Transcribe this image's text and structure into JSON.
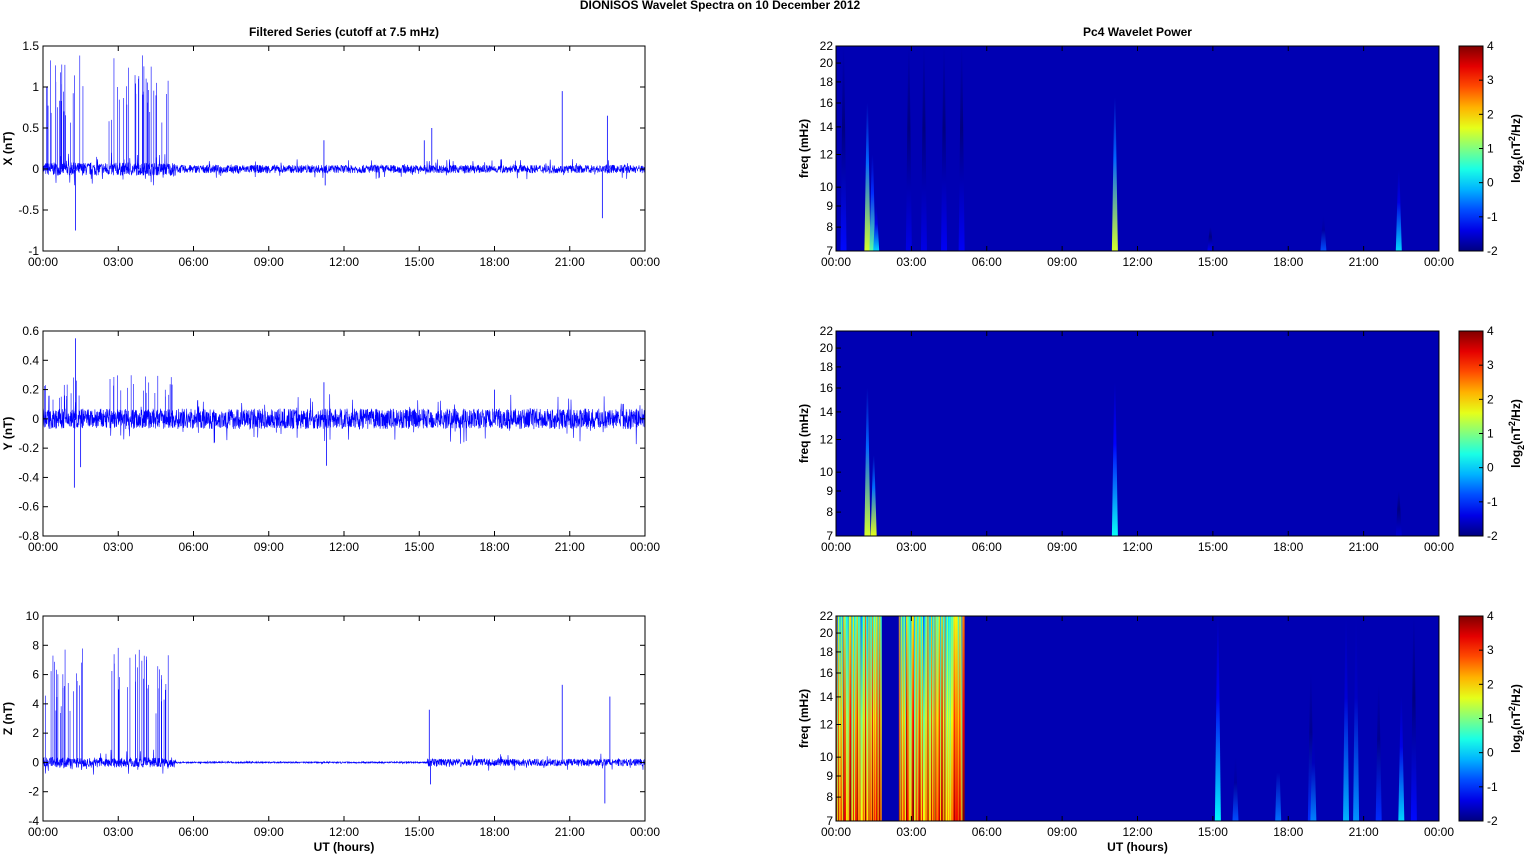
{
  "title": "DIONISOS Wavelet Spectra on 10 December  2012",
  "chart_data": [
    {
      "type": "line",
      "title": "Filtered Series (cutoff at 7.5 mHz)",
      "ylabel": "X (nT)",
      "xlabel": "",
      "ylim": [
        -1,
        1.5
      ],
      "yticks": [
        "-1",
        "-0.5",
        "0",
        "0.5",
        "1",
        "1.5"
      ],
      "yvals": [
        -1,
        -0.5,
        0,
        0.5,
        1,
        1.5
      ],
      "xlim": [
        0,
        24
      ],
      "xticks": [
        "00:00",
        "03:00",
        "06:00",
        "09:00",
        "12:00",
        "15:00",
        "18:00",
        "21:00",
        "00:00"
      ],
      "color": "#0000ff",
      "noise": [
        {
          "start": 0,
          "end": 5.3,
          "amp": 0.08
        },
        {
          "start": 5.3,
          "end": 24,
          "amp": 0.05
        }
      ],
      "bursts": [
        {
          "start": 0.05,
          "end": 1.6,
          "max": 1.4,
          "count": 22
        },
        {
          "start": 2.6,
          "end": 5.2,
          "max": 1.4,
          "count": 30
        }
      ],
      "spikes": [
        {
          "t": 1.3,
          "v": -0.75
        },
        {
          "t": 11.2,
          "v": 0.35
        },
        {
          "t": 11.25,
          "v": -0.2
        },
        {
          "t": 15.2,
          "v": 0.35
        },
        {
          "t": 15.5,
          "v": 0.5
        },
        {
          "t": 20.7,
          "v": 0.95
        },
        {
          "t": 22.5,
          "v": 0.65
        },
        {
          "t": 22.3,
          "v": -0.6
        }
      ]
    },
    {
      "type": "line",
      "title": "",
      "ylabel": "Y (nT)",
      "xlabel": "",
      "ylim": [
        -0.8,
        0.6
      ],
      "yticks": [
        "-0.8",
        "-0.6",
        "-0.4",
        "-0.2",
        "0",
        "0.2",
        "0.4",
        "0.6"
      ],
      "yvals": [
        -0.8,
        -0.6,
        -0.4,
        -0.2,
        0,
        0.2,
        0.4,
        0.6
      ],
      "xlim": [
        0,
        24
      ],
      "xticks": [
        "00:00",
        "03:00",
        "06:00",
        "09:00",
        "12:00",
        "15:00",
        "18:00",
        "21:00",
        "00:00"
      ],
      "color": "#0000ff",
      "noise": [
        {
          "start": 0,
          "end": 24,
          "amp": 0.07
        }
      ],
      "bursts": [
        {
          "start": 0.05,
          "end": 1.6,
          "max": 0.3,
          "count": 15
        },
        {
          "start": 2.6,
          "end": 5.2,
          "max": 0.3,
          "count": 20
        }
      ],
      "spikes": [
        {
          "t": 1.3,
          "v": 0.55
        },
        {
          "t": 1.25,
          "v": -0.47
        },
        {
          "t": 1.5,
          "v": -0.33
        },
        {
          "t": 11.2,
          "v": 0.25
        },
        {
          "t": 11.3,
          "v": -0.32
        },
        {
          "t": 18,
          "v": 0.2
        },
        {
          "t": 24,
          "v": 0.2
        }
      ]
    },
    {
      "type": "line",
      "title": "",
      "ylabel": "Z (nT)",
      "xlabel": "UT (hours)",
      "ylim": [
        -4,
        10
      ],
      "yticks": [
        "-4",
        "-2",
        "0",
        "2",
        "4",
        "6",
        "8",
        "10"
      ],
      "yvals": [
        -4,
        -2,
        0,
        2,
        4,
        6,
        8,
        10
      ],
      "xlim": [
        0,
        24
      ],
      "xticks": [
        "00:00",
        "03:00",
        "06:00",
        "09:00",
        "12:00",
        "15:00",
        "18:00",
        "21:00",
        "00:00"
      ],
      "color": "#0000ff",
      "noise": [
        {
          "start": 0,
          "end": 5.3,
          "amp": 0.35
        },
        {
          "start": 5.3,
          "end": 15.3,
          "amp": 0.05
        },
        {
          "start": 15.3,
          "end": 24,
          "amp": 0.25
        }
      ],
      "bursts": [
        {
          "start": 0.05,
          "end": 1.6,
          "max": 8,
          "count": 22
        },
        {
          "start": 2.6,
          "end": 5.2,
          "max": 8,
          "count": 30
        }
      ],
      "spikes": [
        {
          "t": 15.4,
          "v": 3.6
        },
        {
          "t": 15.45,
          "v": -1.5
        },
        {
          "t": 20.7,
          "v": 5.3
        },
        {
          "t": 22.6,
          "v": 4.5
        },
        {
          "t": 22.4,
          "v": -2.8
        }
      ]
    },
    {
      "type": "heatmap",
      "title": "Pc4 Wavelet Power",
      "ylabel": "freq (mHz)",
      "xlabel": "",
      "xlim": [
        0,
        24
      ],
      "ylim": [
        7,
        22
      ],
      "yscale": "log",
      "yticks": [
        "7",
        "8",
        "9",
        "10",
        "12",
        "14",
        "16",
        "18",
        "20",
        "22"
      ],
      "yvals": [
        7,
        8,
        9,
        10,
        12,
        14,
        16,
        18,
        20,
        22
      ],
      "xticks": [
        "00:00",
        "03:00",
        "06:00",
        "09:00",
        "12:00",
        "15:00",
        "18:00",
        "21:00",
        "00:00"
      ],
      "colorbar": {
        "label": "log2(nT2/Hz)",
        "range": [
          -2,
          4
        ],
        "ticks": [
          "-2",
          "-1",
          "0",
          "1",
          "2",
          "3",
          "4"
        ],
        "tvals": [
          -2,
          -1,
          0,
          1,
          2,
          3,
          4
        ]
      },
      "features": [
        {
          "t": 1.25,
          "fmax": 16,
          "peak": 1.5
        },
        {
          "t": 1.45,
          "fmax": 12,
          "peak": 0.8
        },
        {
          "t": 1.6,
          "fmax": 9,
          "peak": 0
        },
        {
          "t": 11.1,
          "fmax": 16.5,
          "peak": 1.5
        },
        {
          "t": 19.4,
          "fmax": 8.5,
          "peak": -0.8
        },
        {
          "t": 22.4,
          "fmax": 11,
          "peak": 0
        },
        {
          "t": 0.3,
          "fmax": 22,
          "peak": -1.2
        },
        {
          "t": 2.9,
          "fmax": 22,
          "peak": -1.4
        },
        {
          "t": 3.5,
          "fmax": 22,
          "peak": -1.4
        },
        {
          "t": 4.3,
          "fmax": 22,
          "peak": -1.3
        },
        {
          "t": 5.0,
          "fmax": 22,
          "peak": -1.3
        },
        {
          "t": 14.9,
          "fmax": 8,
          "peak": -1.3
        }
      ],
      "broadband": []
    },
    {
      "type": "heatmap",
      "title": "",
      "ylabel": "freq (mHz)",
      "xlabel": "",
      "xlim": [
        0,
        24
      ],
      "ylim": [
        7,
        22
      ],
      "yscale": "log",
      "yticks": [
        "7",
        "8",
        "9",
        "10",
        "12",
        "14",
        "16",
        "18",
        "20",
        "22"
      ],
      "yvals": [
        7,
        8,
        9,
        10,
        12,
        14,
        16,
        18,
        20,
        22
      ],
      "xticks": [
        "00:00",
        "03:00",
        "06:00",
        "09:00",
        "12:00",
        "15:00",
        "18:00",
        "21:00",
        "00:00"
      ],
      "colorbar": {
        "label": "log2(nT2/Hz)",
        "range": [
          -2,
          4
        ],
        "ticks": [
          "-2",
          "-1",
          "0",
          "1",
          "2",
          "3",
          "4"
        ],
        "tvals": [
          -2,
          -1,
          0,
          1,
          2,
          3,
          4
        ]
      },
      "features": [
        {
          "t": 1.25,
          "fmax": 16,
          "peak": 1.5
        },
        {
          "t": 1.5,
          "fmax": 11,
          "peak": 1.6
        },
        {
          "t": 11.1,
          "fmax": 16.5,
          "peak": 0.3
        },
        {
          "t": 22.4,
          "fmax": 9,
          "peak": -1.5
        }
      ],
      "broadband": []
    },
    {
      "type": "heatmap",
      "title": "",
      "ylabel": "freq (mHz)",
      "xlabel": "UT (hours)",
      "xlim": [
        0,
        24
      ],
      "ylim": [
        7,
        22
      ],
      "yscale": "log",
      "yticks": [
        "7",
        "8",
        "9",
        "10",
        "12",
        "14",
        "16",
        "18",
        "20",
        "22"
      ],
      "yvals": [
        7,
        8,
        9,
        10,
        12,
        14,
        16,
        18,
        20,
        22
      ],
      "xticks": [
        "00:00",
        "03:00",
        "06:00",
        "09:00",
        "12:00",
        "15:00",
        "18:00",
        "21:00",
        "00:00"
      ],
      "colorbar": {
        "label": "log2(nT2/Hz)",
        "range": [
          -2,
          4
        ],
        "ticks": [
          "-2",
          "-1",
          "0",
          "1",
          "2",
          "3",
          "4"
        ],
        "tvals": [
          -2,
          -1,
          0,
          1,
          2,
          3,
          4
        ]
      },
      "features": [
        {
          "t": 15.2,
          "fmax": 22,
          "peak": 0.2
        },
        {
          "t": 15.9,
          "fmax": 10,
          "peak": -0.8
        },
        {
          "t": 17.6,
          "fmax": 11,
          "peak": -0.6
        },
        {
          "t": 18.9,
          "fmax": 16,
          "peak": -1
        },
        {
          "t": 19.0,
          "fmax": 12,
          "peak": -0.5
        },
        {
          "t": 20.3,
          "fmax": 22,
          "peak": -0.2
        },
        {
          "t": 20.7,
          "fmax": 22,
          "peak": -0.4
        },
        {
          "t": 21.6,
          "fmax": 15,
          "peak": -1
        },
        {
          "t": 22.5,
          "fmax": 14,
          "peak": 0
        },
        {
          "t": 23.0,
          "fmax": 22,
          "peak": -1.2
        }
      ],
      "broadband": [
        {
          "start": 0,
          "end": 1.8,
          "level": 2.5
        },
        {
          "start": 2.5,
          "end": 5.1,
          "level": 2.2
        }
      ]
    }
  ]
}
